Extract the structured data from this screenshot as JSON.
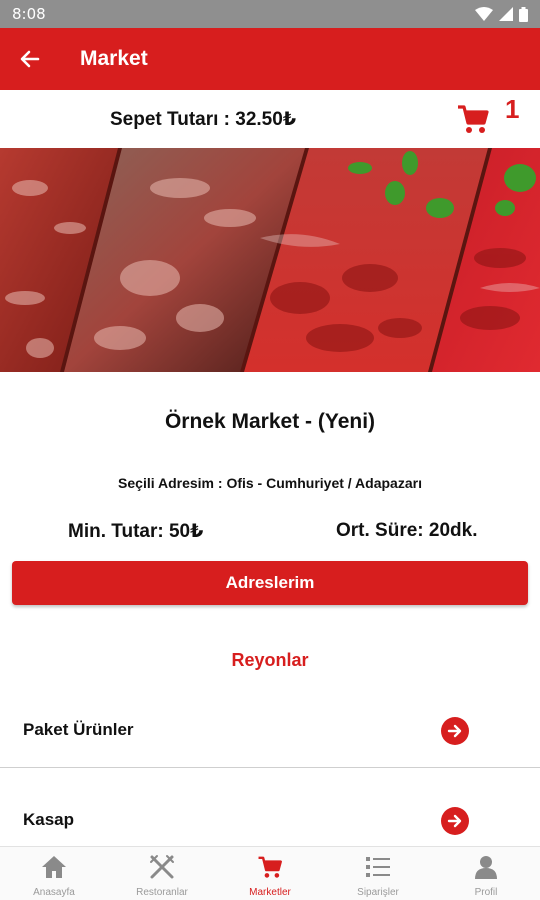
{
  "status_bar": {
    "time": "8:08"
  },
  "app_bar": {
    "title": "Market"
  },
  "cart": {
    "total_text": "Sepet Tutarı : 32.50₺",
    "count": "1"
  },
  "store": {
    "name": "Örnek Market - (Yeni)",
    "address": "Seçili Adresim : Ofis - Cumhuriyet / Adapazarı",
    "min_total": "Min. Tutar: 50₺",
    "avg_time": "Ort. Süre: 20dk."
  },
  "addresses_button": "Adreslerim",
  "departments": {
    "title": "Reyonlar",
    "items": [
      {
        "label": "Paket Ürünler"
      },
      {
        "label": "Kasap"
      }
    ]
  },
  "bottom_nav": {
    "items": [
      {
        "label": "Anasayfa",
        "icon": "home-icon"
      },
      {
        "label": "Restoranlar",
        "icon": "utensils-icon"
      },
      {
        "label": "Marketler",
        "icon": "cart-icon",
        "active": true
      },
      {
        "label": "Siparişler",
        "icon": "list-icon"
      },
      {
        "label": "Profil",
        "icon": "person-icon"
      }
    ]
  },
  "colors": {
    "primary": "#d71e1e",
    "status_bar": "#8f8f8f"
  }
}
